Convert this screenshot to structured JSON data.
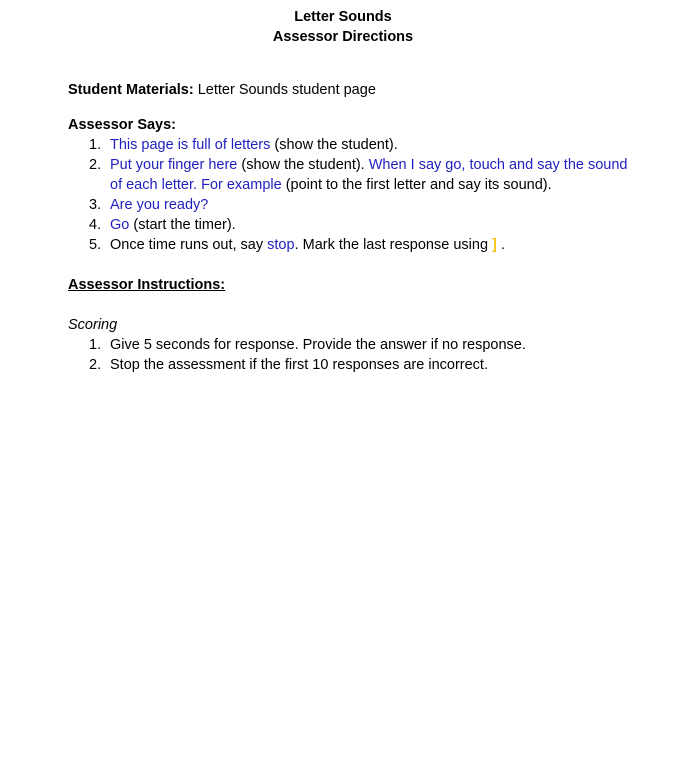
{
  "header": {
    "title": "Letter Sounds",
    "subtitle": "Assessor Directions"
  },
  "materials": {
    "label": "Student Materials:",
    "text": " Letter Sounds student page"
  },
  "assessor_says": {
    "heading": "Assessor Says:",
    "items": [
      {
        "num": "1.",
        "spoken": "This page is full of letters",
        "note": " (show the student)."
      },
      {
        "num": "2.",
        "spoken_a": "Put your finger here",
        "note_a": " (show the student). ",
        "spoken_b": "When I say go, touch and say the sound of each letter. For example",
        "note_b": " (point to the first letter and say its sound)."
      },
      {
        "num": "3.",
        "spoken": "Are you ready?"
      },
      {
        "num": "4.",
        "spoken": "Go",
        "note": " (start the timer)."
      },
      {
        "num": "5.",
        "text_a": "Once time runs out, say ",
        "spoken": "stop",
        "text_b": ". Mark the last response using ",
        "bracket": "]",
        "text_c": "."
      }
    ]
  },
  "instructions": {
    "heading": "Assessor Instructions:"
  },
  "scoring": {
    "heading": "Scoring",
    "items": [
      {
        "num": "1.",
        "text": "Give 5 seconds for response. Provide the answer if no response."
      },
      {
        "num": "2.",
        "text": "Stop the assessment if the first 10 responses are incorrect."
      }
    ]
  },
  "colors": {
    "spoken_text": "#1f1fbf",
    "bracket_mark": "#f5c518"
  }
}
